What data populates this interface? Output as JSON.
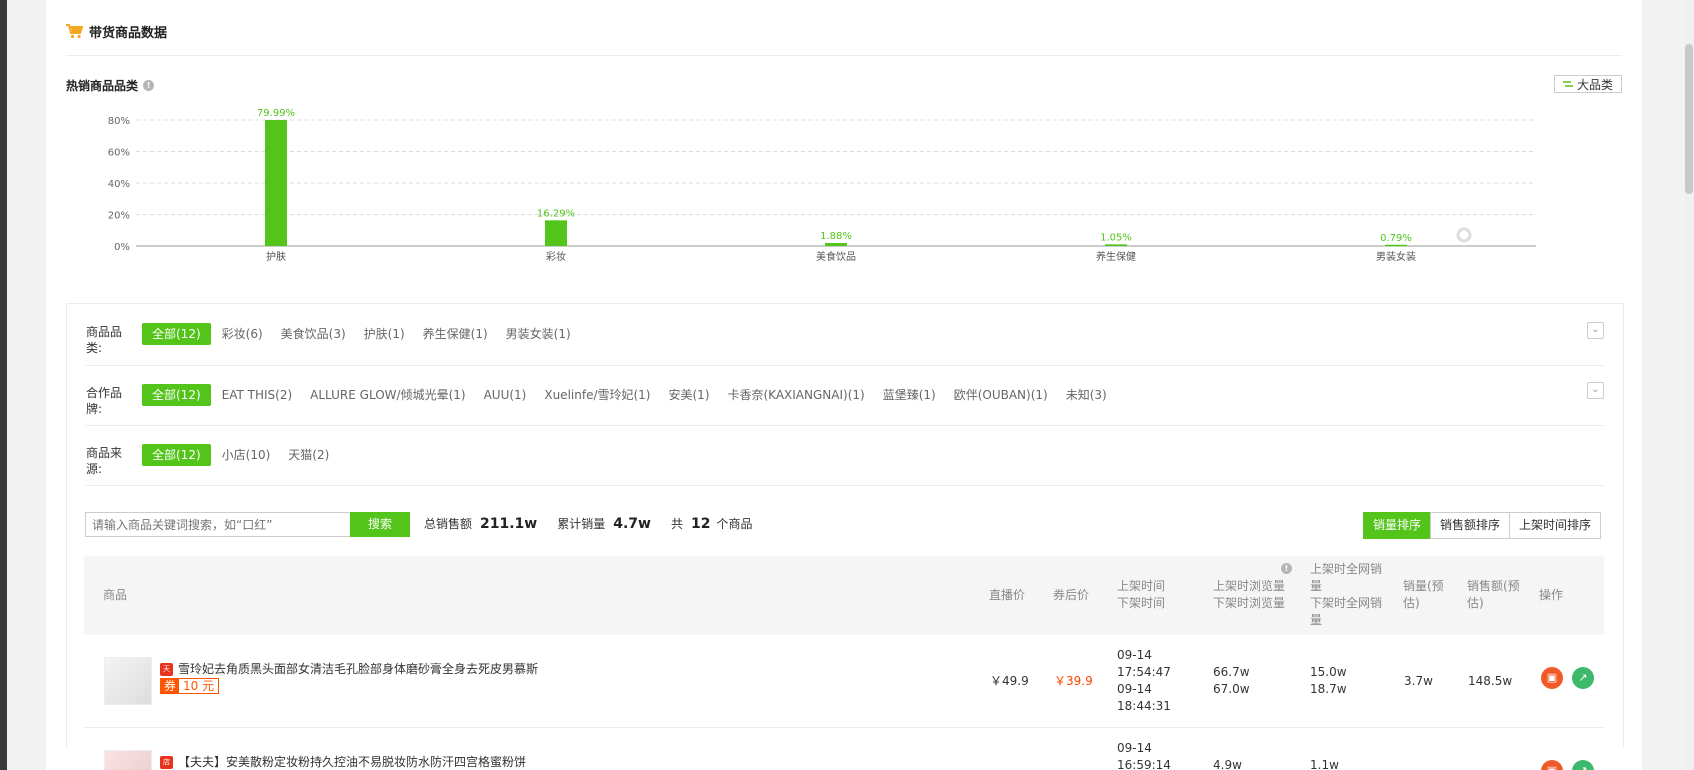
{
  "panel": {
    "title": "带货商品数据"
  },
  "section": {
    "title": "热销商品品类",
    "bigcat_label": "大品类"
  },
  "chart_data": {
    "type": "bar",
    "categories": [
      "护肤",
      "彩妆",
      "美食饮品",
      "养生保健",
      "男装女装"
    ],
    "values": [
      79.99,
      16.29,
      1.88,
      1.05,
      0.79
    ],
    "value_labels": [
      "79.99%",
      "16.29%",
      "1.88%",
      "1.05%",
      "0.79%"
    ],
    "yticks": [
      "0%",
      "20%",
      "40%",
      "60%",
      "80%"
    ],
    "ylim": [
      0,
      80
    ],
    "grid": true,
    "color": "#52c41a"
  },
  "filters": {
    "category": {
      "label": "商品品类:",
      "options": [
        "全部(12)",
        "彩妆(6)",
        "美食饮品(3)",
        "护肤(1)",
        "养生保健(1)",
        "男装女装(1)"
      ]
    },
    "brand": {
      "label": "合作品牌:",
      "options": [
        "全部(12)",
        "EAT THIS(2)",
        "ALLURE GLOW/倾城光晕(1)",
        "AUU(1)",
        "Xuelinfe/雪玲妃(1)",
        "安美(1)",
        "卡香奈(KAXIANGNAI)(1)",
        "蓝堡臻(1)",
        "欧伴(OUBAN)(1)",
        "未知(3)"
      ]
    },
    "source": {
      "label": "商品来源:",
      "options": [
        "全部(12)",
        "小店(10)",
        "天猫(2)"
      ]
    }
  },
  "search": {
    "placeholder": "请输入商品关键词搜索，如“口红”",
    "button": "搜索"
  },
  "stats": {
    "gmv_label": "总销售额",
    "gmv": "211.1w",
    "sales_label": "累计销量",
    "sales": "4.7w",
    "total_prefix": "共",
    "total": "12",
    "total_suffix": "个商品"
  },
  "sort": {
    "options": [
      "销量排序",
      "销售额排序",
      "上架时间排序"
    ]
  },
  "table": {
    "headers": {
      "product": "商品",
      "live_price": "直播价",
      "coupon_price": "券后价",
      "time_up": "上架时间",
      "time_down": "下架时间",
      "views_up": "上架时浏览量",
      "views_down": "下架时浏览量",
      "net_up_1": "上架时全网销",
      "net_up_2": "量",
      "net_down_1": "下架时全网销",
      "net_down_2": "量",
      "sales_1": "销量(预",
      "sales_2": "估)",
      "gmv_1": "销售额(预",
      "gmv_2": "估)",
      "op": "操作"
    },
    "rows": [
      {
        "name": "雪玲妃去角质黑头面部女清洁毛孔脸部身体磨砂膏全身去死皮男慕斯",
        "shop_badge": "天猫",
        "coupon_label": "券",
        "coupon_value": "10 元",
        "live_price": "￥49.9",
        "coupon_price": "￥39.9",
        "date_up": "09-14",
        "time_up": "17:54:47",
        "date_down": "09-14",
        "time_down": "18:44:31",
        "views_up": "66.7w",
        "views_down": "67.0w",
        "net_up": "15.0w",
        "net_down": "18.7w",
        "sales": "3.7w",
        "gmv": "148.5w"
      },
      {
        "name": "【夫夫】安美散粉定妆粉持久控油不易脱妆防水防汗四宫格蜜粉饼",
        "shop_badge": "店",
        "date_up": "09-14",
        "time_up": "16:59:14",
        "views_up": "4.9w",
        "net_up": "1.1w"
      }
    ]
  }
}
